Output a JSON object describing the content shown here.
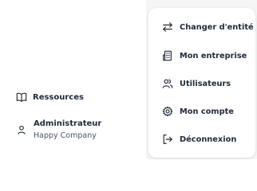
{
  "sidebar": {
    "resources_label": "Ressources",
    "user": {
      "name": "Administrateur",
      "company": "Happy Company"
    }
  },
  "menu": {
    "items": [
      {
        "label": "Changer d'entité",
        "icon": "switch-arrows-icon"
      },
      {
        "label": "Mon entreprise",
        "icon": "building-icon"
      },
      {
        "label": "Utilisateurs",
        "icon": "users-icon"
      },
      {
        "label": "Mon compte",
        "icon": "gear-icon"
      },
      {
        "label": "Déconnexion",
        "icon": "logout-icon"
      }
    ]
  }
}
